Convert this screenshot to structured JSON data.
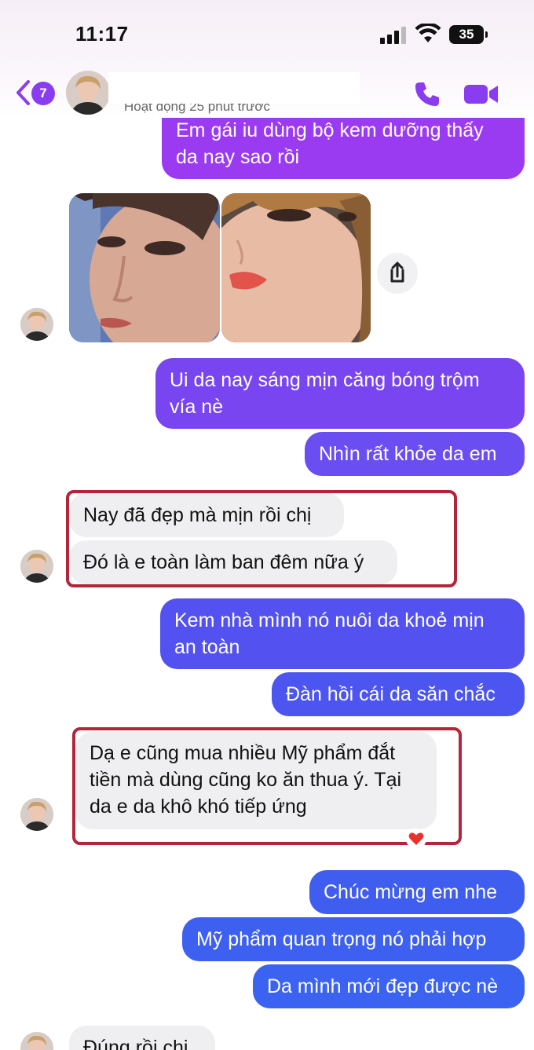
{
  "status_bar": {
    "time": "11:17",
    "battery": "35"
  },
  "header": {
    "back_badge": "7",
    "active_status": "Hoạt động 25 phút trước"
  },
  "messages": [
    {
      "side": "out",
      "text": "Em gái iu dùng bộ kem dưỡng thấy da nay sao rồi"
    },
    {
      "side": "in",
      "type": "photos",
      "count": 2
    },
    {
      "side": "out",
      "text": "Ui da nay sáng mịn căng bóng trộm vía nè"
    },
    {
      "side": "out",
      "text": "Nhìn rất khỏe da em"
    },
    {
      "side": "in",
      "text": "Nay đã đẹp mà mịn rồi chị"
    },
    {
      "side": "in",
      "text": "Đó là e toàn làm ban đêm nữa ý"
    },
    {
      "side": "out",
      "text": "Kem nhà mình nó nuôi da khoẻ mịn an toàn"
    },
    {
      "side": "out",
      "text": "Đàn hồi cái da săn chắc"
    },
    {
      "side": "in",
      "text": "Dạ e cũng mua nhiều Mỹ phẩm đắt tiền mà dùng cũng ko ăn thua ý. Tại da e da khô khó tiếp ứng"
    },
    {
      "side": "out",
      "text": "Chúc mừng em nhe"
    },
    {
      "side": "out",
      "text": "Mỹ phẩm quan trọng nó phải hợp"
    },
    {
      "side": "out",
      "text": "Da mình mới đẹp được nè"
    },
    {
      "side": "in",
      "text": "Đúng rồi chị"
    }
  ],
  "colors": {
    "accent": "#8a3cf0",
    "bubble_gradient_top": "#9b3bf2",
    "bubble_gradient_bottom": "#3d5ef0",
    "incoming_bubble": "#efeff1",
    "highlight_border": "#b2263a"
  },
  "icons": {
    "back": "chevron-left-icon",
    "call": "phone-icon",
    "video": "video-camera-icon",
    "share": "share-icon",
    "reaction": "heart-icon"
  }
}
